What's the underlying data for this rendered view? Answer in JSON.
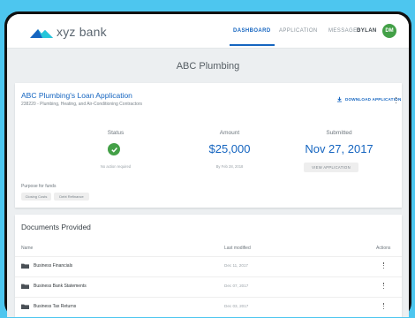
{
  "brand": {
    "name": "xyz bank"
  },
  "nav": {
    "dashboard": "DASHBOARD",
    "application": "APPLICATION",
    "messages": "MESSAGES",
    "user": "DYLAN",
    "avatar_initials": "DM"
  },
  "page_title": "ABC Plumbing",
  "loan": {
    "title": "ABC Plumbing's Loan Application",
    "subtitle": "238220 - Plumbing, Heating, and Air-Conditioning Contractors",
    "download_label": "DOWNLOAD APPLICATION",
    "status_label": "Status",
    "status_note": "No action required",
    "amount_label": "Amount",
    "amount_value": "$25,000",
    "amount_note": "By Feb 28, 2018",
    "submitted_label": "Submitted",
    "submitted_value": "Nov 27, 2017",
    "view_label": "VIEW APPLICATION",
    "purpose_label": "Purpose for funds",
    "purposes": [
      "Closing Costs",
      "Debt Refinance"
    ]
  },
  "documents": {
    "title": "Documents Provided",
    "columns": {
      "name": "Name",
      "modified": "Last modified",
      "actions": "Actions"
    },
    "rows": [
      {
        "name": "Business Financials",
        "modified": "Dec 11, 2017"
      },
      {
        "name": "Business Bank Statements",
        "modified": "Dec 07, 2017"
      },
      {
        "name": "Business Tax Returns",
        "modified": "Dec 03, 2017"
      }
    ]
  },
  "colors": {
    "accent": "#1565c0",
    "success": "#43a047",
    "background": "#4dc6ef"
  },
  "icons": [
    "logo-icon",
    "download-icon",
    "more-vert-icon",
    "check-circle-icon",
    "folder-icon"
  ]
}
